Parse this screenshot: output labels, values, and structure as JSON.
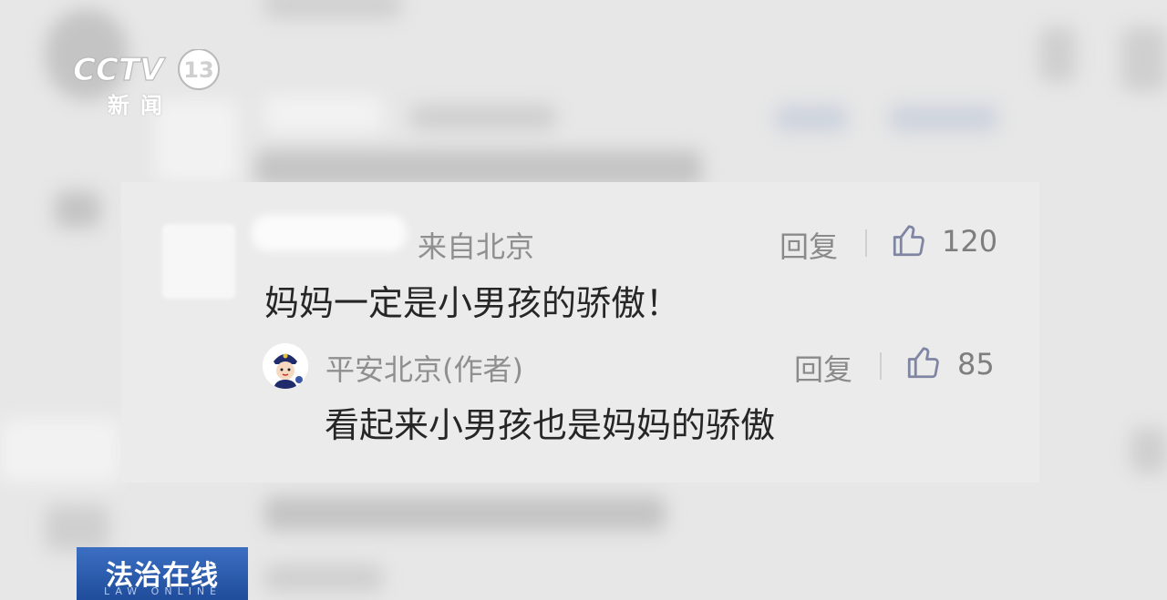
{
  "channel": {
    "logo_text": "CCTV",
    "channel_number": "13",
    "sub": "新闻"
  },
  "comment": {
    "location": "来自北京",
    "text": "妈妈一定是小男孩的骄傲！",
    "reply_label": "回复",
    "likes": "120"
  },
  "author_reply": {
    "author": "平安北京(作者)",
    "text": "看起来小男孩也是妈妈的骄傲",
    "reply_label": "回复",
    "likes": "85"
  },
  "program": {
    "title": "法治在线",
    "subtitle": "LAW ONLINE"
  }
}
